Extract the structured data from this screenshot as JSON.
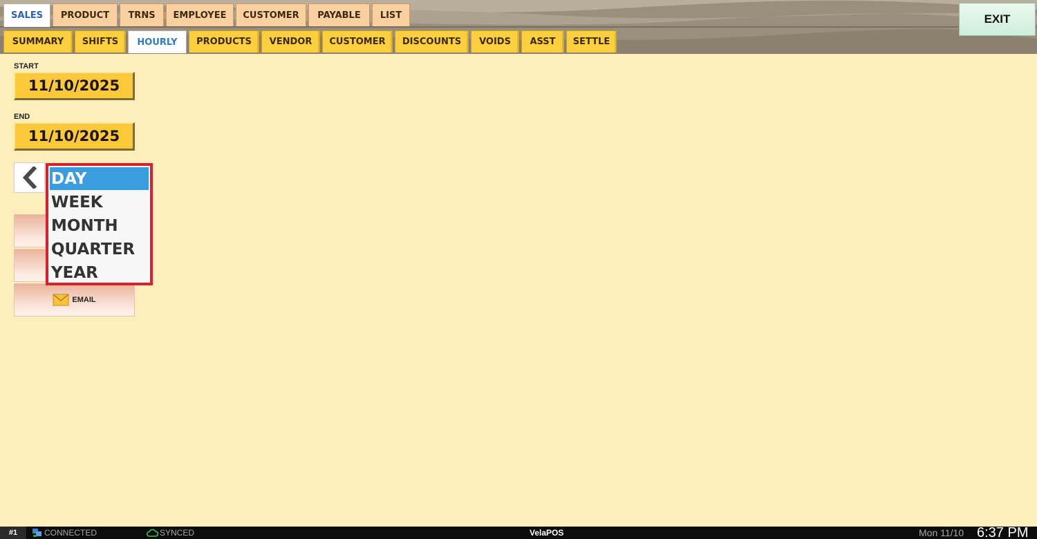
{
  "main_tabs": [
    {
      "id": "sales",
      "label": "SALES"
    },
    {
      "id": "product",
      "label": "PRODUCT"
    },
    {
      "id": "trns",
      "label": "TRNS"
    },
    {
      "id": "employee",
      "label": "EMPLOYEE"
    },
    {
      "id": "customer",
      "label": "CUSTOMER"
    },
    {
      "id": "payable",
      "label": "PAYABLE"
    },
    {
      "id": "list",
      "label": "LIST"
    }
  ],
  "main_tabs_active": "SALES",
  "sub_tabs": [
    {
      "id": "summary",
      "label": "SUMMARY"
    },
    {
      "id": "shifts",
      "label": "SHIFTS"
    },
    {
      "id": "hourly",
      "label": "HOURLY"
    },
    {
      "id": "products",
      "label": "PRODUCTS"
    },
    {
      "id": "vendor",
      "label": "VENDOR"
    },
    {
      "id": "customer",
      "label": "CUSTOMER"
    },
    {
      "id": "discounts",
      "label": "DISCOUNTS"
    },
    {
      "id": "voids",
      "label": "VOIDS"
    },
    {
      "id": "asst",
      "label": "ASST"
    },
    {
      "id": "settle",
      "label": "SETTLE"
    }
  ],
  "sub_tabs_active": "HOURLY",
  "exit_label": "EXIT",
  "start": {
    "label": "START",
    "value": "11/10/2025"
  },
  "end": {
    "label": "END",
    "value": "11/10/2025"
  },
  "range_dropdown": {
    "options": [
      "DAY",
      "WEEK",
      "MONTH",
      "QUARTER",
      "YEAR"
    ],
    "selected": "DAY"
  },
  "email_button": {
    "label": "EMAIL",
    "icon": "envelope-icon"
  },
  "status_bar": {
    "terminal": "#1",
    "connection": "CONNECTED",
    "sync": "SYNCED",
    "app_name": "VelaPOS",
    "date": "Mon 11/10",
    "time": "6:37 PM"
  },
  "colors": {
    "background": "#fdeebb",
    "header": "#9a8e7d",
    "main_tab": "#fbd0a0",
    "sub_tab": "#fbcf3e",
    "date_button": "#fbc93a",
    "dropdown_selected": "#3a9de0",
    "dropdown_border": "#d8202f",
    "exit_button": "#dff3e6"
  }
}
